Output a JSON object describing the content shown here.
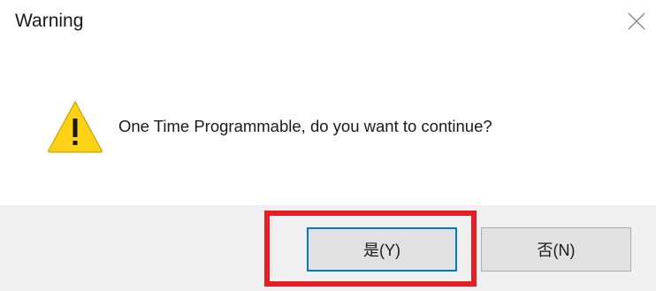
{
  "dialog": {
    "title": "Warning",
    "close_icon": "close-icon",
    "message": "One Time Programmable, do you want to continue?",
    "warning_icon": "warning-icon",
    "buttons": {
      "yes_label": "是(Y)",
      "no_label": "否(N)"
    }
  },
  "colors": {
    "warning_yellow": "#fcd116",
    "focus_border": "#0078d7",
    "highlight_red": "#e51f25",
    "footer_bg": "#f0f0f0"
  }
}
